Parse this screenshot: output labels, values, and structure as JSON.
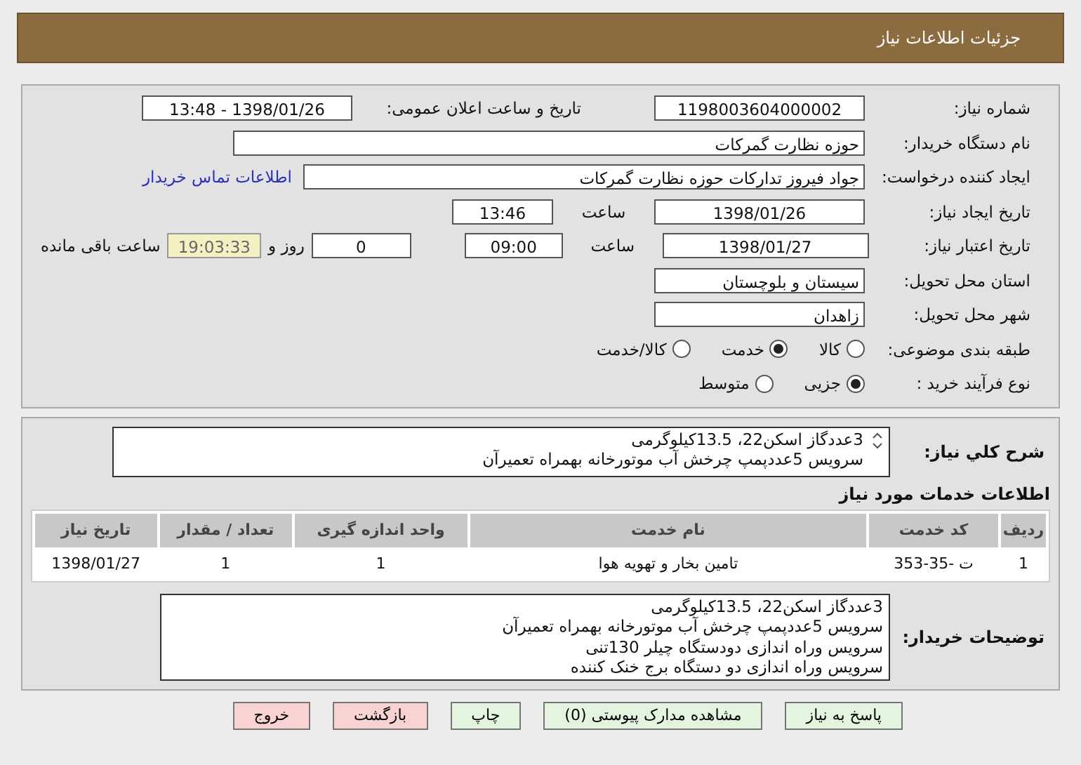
{
  "header": {
    "title": "جزئیات اطلاعات نیاز"
  },
  "need_number": {
    "label": "شماره نیاز:",
    "value": "1198003604000002"
  },
  "announce": {
    "label": "تاریخ و ساعت اعلان عمومی:",
    "value": "1398/01/26 - 13:48"
  },
  "buyer_org": {
    "label": "نام دستگاه خریدار:",
    "value": "حوزه نظارت گمرکات"
  },
  "requester": {
    "label": "ایجاد کننده درخواست:",
    "value": "جواد فیروز تدارکات حوزه نظارت گمرکات",
    "link": "اطلاعات تماس خریدار"
  },
  "created": {
    "label": "تاریخ ایجاد نیاز:",
    "date": "1398/01/26",
    "time_label": "ساعت",
    "time": "13:46"
  },
  "validity": {
    "label": "تاریخ اعتبار نیاز:",
    "date": "1398/01/27",
    "time_label": "ساعت",
    "time": "09:00",
    "days": "0",
    "days_label": "روز و",
    "remaining": "19:03:33",
    "remaining_label": "ساعت باقی مانده"
  },
  "province": {
    "label": "استان محل تحویل:",
    "value": "سیستان و بلوچستان"
  },
  "city": {
    "label": "شهر محل تحویل:",
    "value": "زاهدان"
  },
  "category": {
    "label": "طبقه بندی موضوعی:",
    "options": [
      {
        "label": "کالا",
        "selected": false
      },
      {
        "label": "خدمت",
        "selected": true
      },
      {
        "label": "کالا/خدمت",
        "selected": false
      }
    ]
  },
  "process": {
    "label": "نوع فرآیند خرید :",
    "options": [
      {
        "label": "جزیی",
        "selected": true
      },
      {
        "label": "متوسط",
        "selected": false
      }
    ]
  },
  "description": {
    "label": "شرح کلي نياز:",
    "lines": [
      "3عددگاز اسکن22،  13.5کیلوگرمی",
      "سرویس 5عددپمپ چرخش آب موتورخانه بهمراه تعمیرآن"
    ]
  },
  "services": {
    "title": "اطلاعات خدمات مورد نیاز",
    "columns": [
      "ردیف",
      "کد خدمت",
      "نام خدمت",
      "واحد اندازه گیری",
      "تعداد / مقدار",
      "تاریخ نیاز"
    ],
    "rows": [
      [
        "1",
        "ت -35-353",
        "تامین بخار و تهویه هوا",
        "1",
        "1",
        "1398/01/27"
      ]
    ]
  },
  "notes": {
    "label": "توضیحات خریدار:",
    "lines": [
      "3عددگاز اسکن22،  13.5کیلوگرمی",
      "سرویس 5عددپمپ چرخش آب موتورخانه بهمراه تعمیرآن",
      "سرویس وراه اندازی دودستگاه چیلر 130تنی",
      "سرویس وراه اندازی دو دستگاه برج خنک کننده"
    ]
  },
  "buttons": [
    {
      "label": "پاسخ به نیاز",
      "kind": "action"
    },
    {
      "label": "مشاهده مدارک پیوستی (0)",
      "kind": "action"
    },
    {
      "label": "چاپ",
      "kind": "action"
    },
    {
      "label": "بازگشت",
      "kind": "exit"
    },
    {
      "label": "خروج",
      "kind": "exit"
    }
  ]
}
